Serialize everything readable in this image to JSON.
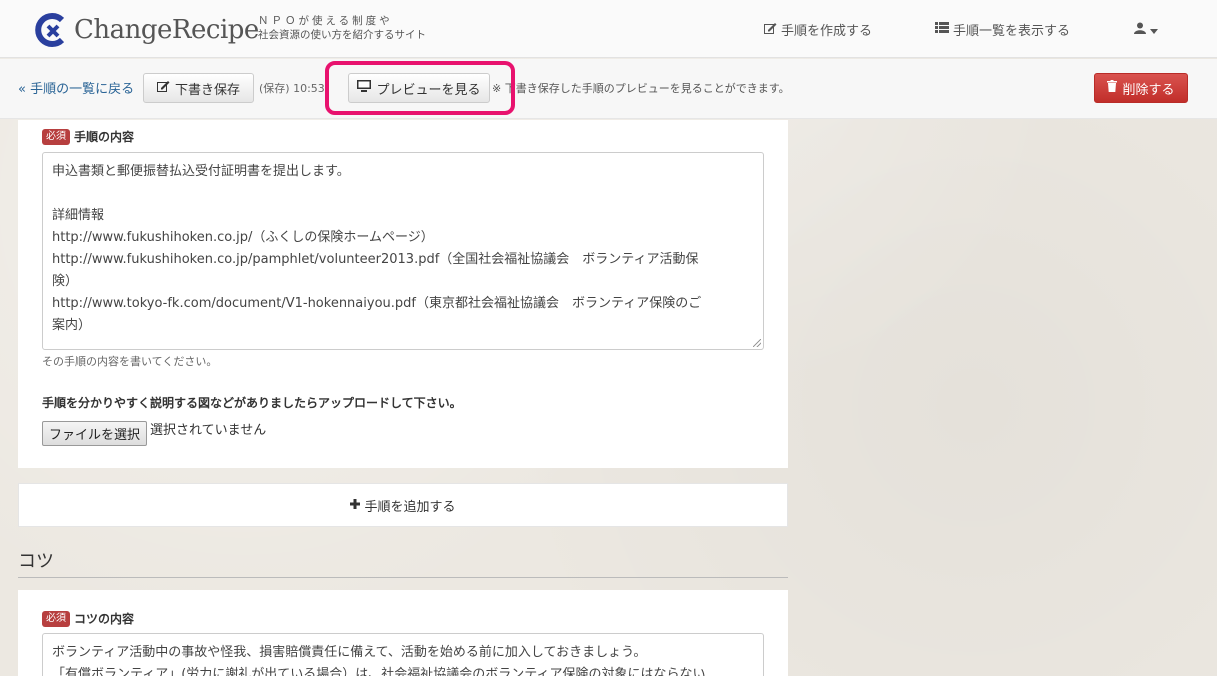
{
  "brand": {
    "name": "ChangeRecipe",
    "tagline_line1": "ＮＰＯが使える制度や",
    "tagline_line2": "社会資源の使い方を紹介するサイト"
  },
  "nav": {
    "create": "手順を作成する",
    "list": "手順一覧を表示する"
  },
  "toolbar": {
    "back": "« 手順の一覧に戻る",
    "save": "下書き保存",
    "saved_at": "(保存) 10:53",
    "preview": "プレビューを見る",
    "preview_note": "※ 下書き保存した手順のプレビューを見ることができます。",
    "delete": "削除する"
  },
  "step": {
    "badge": "必須",
    "label": "手順の内容",
    "lines": [
      "申込書類と郵便振替払込受付証明書を提出します。",
      "",
      "詳細情報",
      "http://www.fukushihoken.co.jp/（ふくしの保険ホームページ）",
      "http://www.fukushihoken.co.jp/pamphlet/volunteer2013.pdf（全国社会福祉協議会　ボランティア活動保",
      "険）",
      "http://www.tokyo-fk.com/document/V1-hokennaiyou.pdf（東京都社会福祉協議会　ボランティア保険のご",
      "案内）"
    ],
    "help": "その手順の内容を書いてください。",
    "upload_label": "手順を分かりやすく説明する図などがありましたらアップロードして下さい。",
    "file_button": "ファイルを選択",
    "file_status": "選択されていません"
  },
  "add_step": "手順を追加する",
  "tips": {
    "title": "コツ",
    "badge": "必須",
    "label": "コツの内容",
    "lines": [
      "ボランティア活動中の事故や怪我、損害賠償責任に備えて、活動を始める前に加入しておきましょう。",
      "「有償ボランティア」(労力に謝礼が出ている場合）は、社会福祉協議会のボランティア保険の対象にはならない"
    ]
  },
  "colors": {
    "highlight": "#e8126e",
    "danger": "#d9534f",
    "badge": "#b73f3f",
    "link": "#2a6496"
  }
}
